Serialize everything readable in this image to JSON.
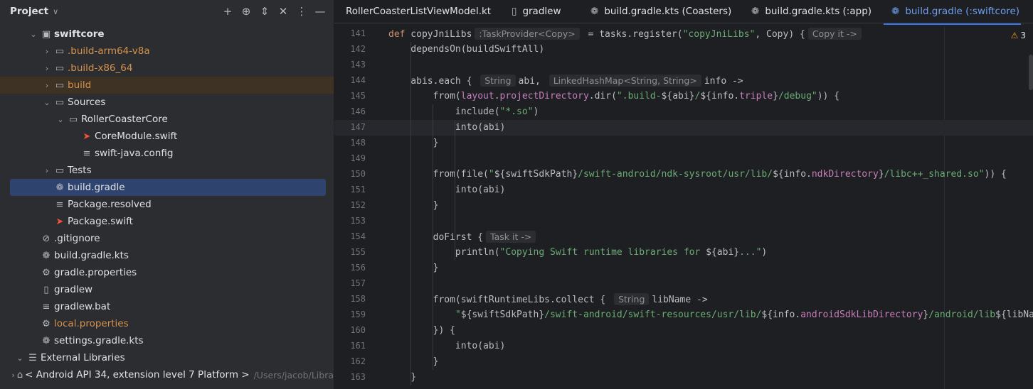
{
  "project_panel": {
    "title": "Project",
    "tools": [
      "add-icon",
      "target-icon",
      "expand-icon",
      "collapse-icon",
      "more-icon",
      "minimize-icon"
    ],
    "tree": [
      {
        "label": "swiftcore",
        "chev": "v",
        "icon": "module-icon",
        "bold": true,
        "level": 2
      },
      {
        "label": ".build-arm64-v8a",
        "chev": ">",
        "icon": "folder-icon",
        "orange": true,
        "level": 3
      },
      {
        "label": ".build-x86_64",
        "chev": ">",
        "icon": "folder-icon",
        "orange": true,
        "level": 3
      },
      {
        "label": "build",
        "chev": ">",
        "icon": "folder-icon",
        "orange": true,
        "level": 3,
        "highlight": true
      },
      {
        "label": "Sources",
        "chev": "v",
        "icon": "folder-icon",
        "level": 3
      },
      {
        "label": "RollerCoasterCore",
        "chev": "v",
        "icon": "folder-icon",
        "level": 4
      },
      {
        "label": "CoreModule.swift",
        "icon": "swift-icon",
        "level": 5
      },
      {
        "label": "swift-java.config",
        "icon": "text-file-icon",
        "level": 5
      },
      {
        "label": "Tests",
        "chev": ">",
        "icon": "folder-icon",
        "level": 3
      },
      {
        "label": "build.gradle",
        "icon": "gradle-icon",
        "level": 3,
        "selected": true
      },
      {
        "label": "Package.resolved",
        "icon": "text-file-icon",
        "level": 3
      },
      {
        "label": "Package.swift",
        "icon": "swift-icon",
        "level": 3
      },
      {
        "label": ".gitignore",
        "icon": "ignore-icon",
        "level": 2
      },
      {
        "label": "build.gradle.kts",
        "icon": "gradle-icon",
        "level": 2
      },
      {
        "label": "gradle.properties",
        "icon": "settings-icon",
        "level": 2
      },
      {
        "label": "gradlew",
        "icon": "file-icon",
        "level": 2
      },
      {
        "label": "gradlew.bat",
        "icon": "text-file-icon",
        "level": 2
      },
      {
        "label": "local.properties",
        "icon": "settings-icon",
        "orange": true,
        "level": 2
      },
      {
        "label": "settings.gradle.kts",
        "icon": "gradle-icon",
        "level": 2
      },
      {
        "label": "External Libraries",
        "chev": "v",
        "icon": "library-icon",
        "level": 1
      },
      {
        "label": "< Android API 34, extension level 7 Platform >",
        "chev": ">",
        "icon": "android-icon",
        "level": 2,
        "suffix": "/Users/jacob/Libra"
      }
    ]
  },
  "tabs": [
    {
      "label": "RollerCoasterListViewModel.kt",
      "icon": "none"
    },
    {
      "label": "gradlew",
      "icon": "file-icon"
    },
    {
      "label": "build.gradle.kts (Coasters)",
      "icon": "gradle-icon"
    },
    {
      "label": "build.gradle.kts (:app)",
      "icon": "gradle-icon"
    },
    {
      "label": "build.gradle (:swiftcore)",
      "icon": "gradle-icon",
      "active": true
    }
  ],
  "editor": {
    "warnings_count": "3",
    "current_line": 147,
    "lines": [
      {
        "n": "141",
        "html": "<span class=\"kw\">def</span> copyJniLibs<span class=\"hint\">:TaskProvider&lt;Copy&gt;</span> = tasks.register(<span class=\"str\">\"copyJniLibs\"</span>, Copy) {<span class=\"hint\">Copy it -&gt;</span>"
      },
      {
        "n": "142",
        "html": "    dependsOn(buildSwiftAll)"
      },
      {
        "n": "143",
        "html": ""
      },
      {
        "n": "144",
        "html": "    abis.each { <span class=\"hint\">String</span>abi, <span class=\"hint\">LinkedHashMap&lt;String, String&gt;</span>info -&gt;"
      },
      {
        "n": "145",
        "html": "        from(<span class=\"prop\">layout</span>.<span class=\"prop\">projectDirectory</span>.dir(<span class=\"str\">\".build-</span>${abi}<span class=\"str\">/</span>${info.<span class=\"prop\">triple</span>}<span class=\"str\">/debug\"</span>)) {"
      },
      {
        "n": "146",
        "html": "            include(<span class=\"str\">\"*.so\"</span>)"
      },
      {
        "n": "147",
        "html": "            into(abi)"
      },
      {
        "n": "148",
        "html": "        }"
      },
      {
        "n": "149",
        "html": ""
      },
      {
        "n": "150",
        "html": "        from(file(<span class=\"str\">\"</span>${swiftSdkPath}<span class=\"str\">/swift-android/ndk-sysroot/usr/lib/</span>${info.<span class=\"prop\">ndkDirectory</span>}<span class=\"str\">/libc++_shared.so\"</span>)) {"
      },
      {
        "n": "151",
        "html": "            into(abi)"
      },
      {
        "n": "152",
        "html": "        }"
      },
      {
        "n": "153",
        "html": ""
      },
      {
        "n": "154",
        "html": "        doFirst {<span class=\"hint\">Task it -&gt;</span>"
      },
      {
        "n": "155",
        "html": "            println(<span class=\"str\">\"Copying Swift runtime libraries for </span>${abi}<span class=\"str\">...\"</span>)"
      },
      {
        "n": "156",
        "html": "        }"
      },
      {
        "n": "157",
        "html": ""
      },
      {
        "n": "158",
        "html": "        from(swiftRuntimeLibs.collect { <span class=\"hint\">String</span>libName -&gt;"
      },
      {
        "n": "159",
        "html": "            <span class=\"str\">\"</span>${swiftSdkPath}<span class=\"str\">/swift-android/swift-resources/usr/lib/</span>${info.<span class=\"prop\">androidSdkLibDirectory</span>}<span class=\"str\">/android/lib</span>${libName}"
      },
      {
        "n": "160",
        "html": "        }) {"
      },
      {
        "n": "161",
        "html": "            into(abi)"
      },
      {
        "n": "162",
        "html": "        }"
      },
      {
        "n": "163",
        "html": "    }"
      }
    ]
  }
}
